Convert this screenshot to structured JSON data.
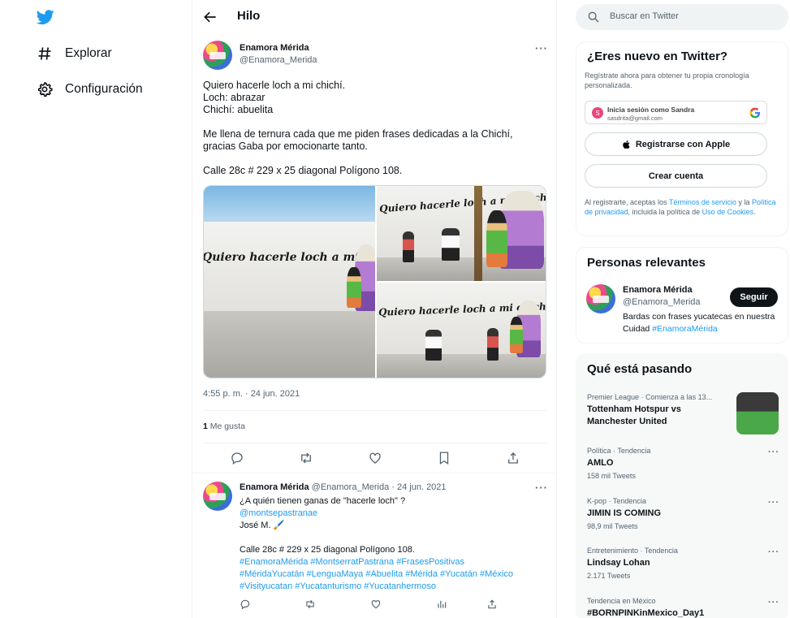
{
  "left_nav": {
    "logo_icon": "twitter-bird-icon",
    "items": [
      {
        "label": "Explorar",
        "icon": "hashtag-icon"
      },
      {
        "label": "Configuración",
        "icon": "gear-icon"
      }
    ]
  },
  "header": {
    "title": "Hilo",
    "back_icon": "back-arrow-icon"
  },
  "main_tweet": {
    "name": "Enamora Mérida",
    "handle": "@Enamora_Merida",
    "text": "Quiero hacerle loch a mi chichí.\nLoch: abrazar\nChichí: abuelita\n\nMe llena de ternura cada que me piden frases dedicadas a la Chichí, gracias Gaba por emocionarte tanto.\n\nCalle 28c # 229 x 25 diagonal Polígono 108.",
    "media": {
      "photo1_text": "Quiero hacerle loch a mi chichi",
      "photo2_text": "Quiero hacerle loch a mi chichi",
      "photo3_text": "Quiero hacerle loch a mi chichi"
    },
    "timestamp": "4:55 p. m. · 24 jun. 2021",
    "likes_count": "1",
    "likes_label": "Me gusta"
  },
  "reply_tweet": {
    "name": "Enamora Mérida",
    "handle": "@Enamora_Merida",
    "date": "· 24 jun. 2021",
    "line1": "¿A quién tienen ganas de \"hacerle loch\" ?",
    "mention": "@montsepastranae",
    "credit": "José M. 🖌️",
    "address": "Calle 28c # 229 x 25 diagonal Polígono 108.",
    "hashtags1": "#EnamoraMérida #MontserratPastrana #FrasesPositivas",
    "hashtags2": "#MéridaYucatán #LenguaMaya #Abuelita #Mérida #Yucatán #México",
    "hashtags3": "#Visityucatan #Yucatanturismo #Yucatanhermoso"
  },
  "search": {
    "placeholder": "Buscar en Twitter"
  },
  "signup": {
    "title": "¿Eres nuevo en Twitter?",
    "subtitle": "Regístrate ahora para obtener tu propia cronología personalizada.",
    "google_name": "Inicia sesión como Sandra",
    "google_email": "sasdrita@gmail.com",
    "google_initial": "S",
    "apple_label": "Registrarse con Apple",
    "create_label": "Crear cuenta",
    "legal_pre": "Al registrarte, aceptas los ",
    "legal_terms": "Términos de servicio",
    "legal_mid1": " y la ",
    "legal_privacy": "Política de privacidad",
    "legal_mid2": ", incluida la política de ",
    "legal_cookies": "Uso de Cookies",
    "legal_end": "."
  },
  "relevant": {
    "title": "Personas relevantes",
    "name": "Enamora Mérida",
    "handle": "@Enamora_Merida",
    "follow_label": "Seguir",
    "bio": "Bardas con frases yucatecas en nuestra Cuidad ",
    "bio_tag": "#EnamoraMérida"
  },
  "trends": {
    "title": "Qué está pasando",
    "items": [
      {
        "meta": "Premier League · Comienza a las 13...",
        "title": "Tottenham Hotspur vs Manchester United",
        "count": ""
      },
      {
        "meta": "Política · Tendencia",
        "title": "AMLO",
        "count": "158 mil Tweets"
      },
      {
        "meta": "K-pop · Tendencia",
        "title": "JIMIN IS COMING",
        "count": "98,9 mil Tweets"
      },
      {
        "meta": "Entretenimiento · Tendencia",
        "title": "Lindsay Lohan",
        "count": "2.171 Tweets"
      },
      {
        "meta": "Tendencia en México",
        "title": "#BORNPINKinMexico_Day1",
        "count": ""
      }
    ]
  },
  "colors": {
    "accent": "#1d9bf0",
    "text": "#0f1419",
    "muted": "#536471",
    "border": "#eff3f4"
  }
}
